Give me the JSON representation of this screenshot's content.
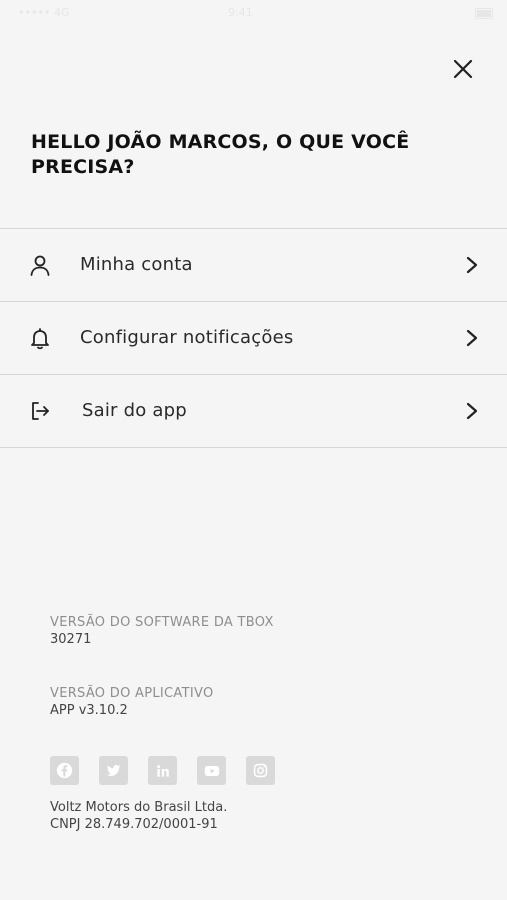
{
  "status_bar": {
    "carrier": "••••• 4G",
    "time": "9:41"
  },
  "header": {
    "close_icon": "close-icon",
    "greeting": "HELLO JOÃO MARCOS, O QUE VOCÊ PRECISA?"
  },
  "menu": {
    "items": [
      {
        "label": "Minha conta",
        "icon": "user-icon"
      },
      {
        "label": "Configurar notificações",
        "icon": "bell-icon"
      },
      {
        "label": "Sair do app",
        "icon": "logout-icon"
      }
    ]
  },
  "info": {
    "tbox_label": "VERSÃO DO SOFTWARE DA TBOX",
    "tbox_value": "30271",
    "app_label": "VERSÃO DO APLICATIVO",
    "app_value": "APP v3.10.2"
  },
  "socials": [
    "facebook-icon",
    "twitter-icon",
    "linkedin-icon",
    "youtube-icon",
    "instagram-icon"
  ],
  "footer": {
    "company": "Voltz Motors do Brasil Ltda.",
    "cnpj": "CNPJ 28.749.702/0001-91"
  },
  "colors": {
    "background": "#f5f5f5",
    "divider": "#d6d6d6",
    "text": "#1e1e1e",
    "muted": "#8e8e8e",
    "social_bg": "#d9d9d9"
  }
}
